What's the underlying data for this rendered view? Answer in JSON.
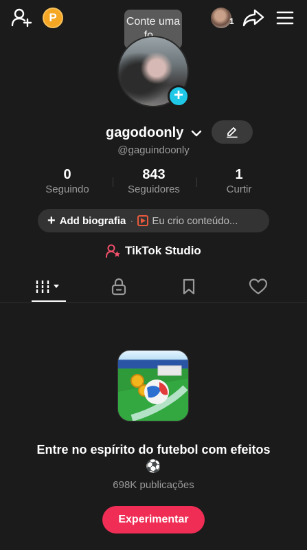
{
  "header": {
    "coin_letter": "P",
    "story_count": "1",
    "tooltip_text": "Conte uma fo..."
  },
  "profile": {
    "display_name": "gagodoonly",
    "username": "@gaguindoonly"
  },
  "stats": [
    {
      "value": "0",
      "label": "Seguindo"
    },
    {
      "value": "843",
      "label": "Seguidores"
    },
    {
      "value": "1",
      "label": "Curtir"
    }
  ],
  "bio": {
    "add_label": "Add biografia",
    "separator": "·",
    "creator_label": "Eu crio conteúdo..."
  },
  "studio": {
    "label": "TikTok Studio"
  },
  "tabs": [
    {
      "name": "videos",
      "icon": "grid-icon",
      "active": true
    },
    {
      "name": "private",
      "icon": "lock-icon",
      "active": false
    },
    {
      "name": "saved",
      "icon": "bookmark-icon",
      "active": false
    },
    {
      "name": "liked",
      "icon": "heart-icon",
      "active": false
    }
  ],
  "promo": {
    "title": "Entre no espírito do futebol com efeitos ⚽",
    "count": "698K publicações",
    "button_label": "Experimentar"
  },
  "colors": {
    "background": "#1b1b1b",
    "accent": "#ef2d55",
    "avatar_add": "#20c8e8",
    "coin": "#f5a623"
  }
}
